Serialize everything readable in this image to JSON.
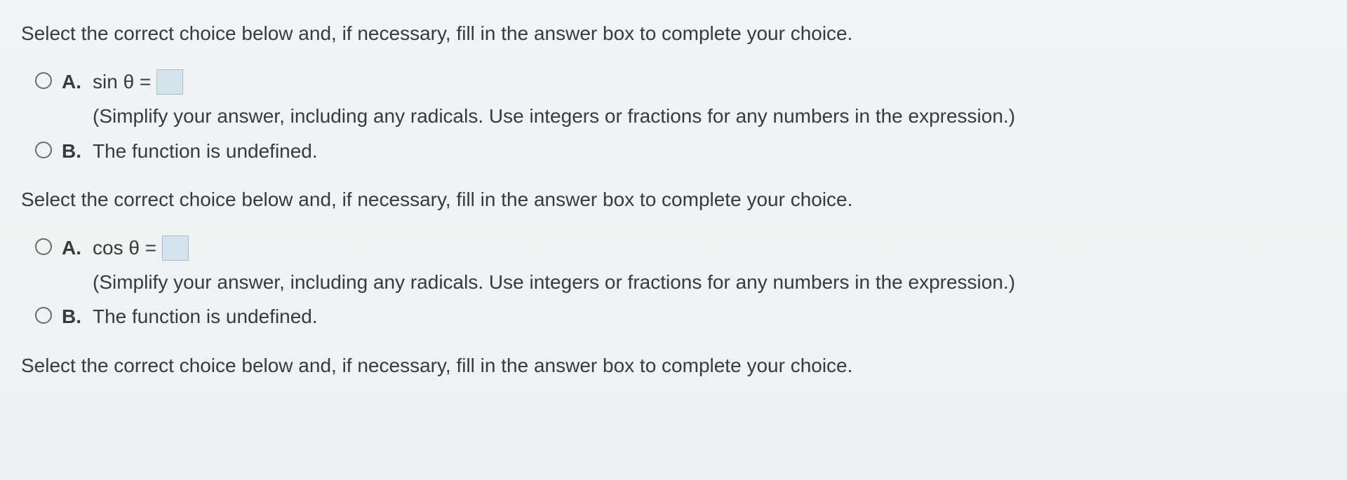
{
  "q1": {
    "prompt": "Select the correct choice below and, if necessary, fill in the answer box to complete your choice.",
    "a": {
      "letter": "A.",
      "expr": "sin θ =",
      "hint": "(Simplify your answer, including any radicals. Use integers or fractions for any numbers in the expression.)"
    },
    "b": {
      "letter": "B.",
      "text": "The function is undefined."
    }
  },
  "q2": {
    "prompt": "Select the correct choice below and, if necessary, fill in the answer box to complete your choice.",
    "a": {
      "letter": "A.",
      "expr": "cos θ =",
      "hint": "(Simplify your answer, including any radicals. Use integers or fractions for any numbers in the expression.)"
    },
    "b": {
      "letter": "B.",
      "text": "The function is undefined."
    }
  },
  "q3": {
    "prompt": "Select the correct choice below and, if necessary, fill in the answer box to complete your choice."
  }
}
